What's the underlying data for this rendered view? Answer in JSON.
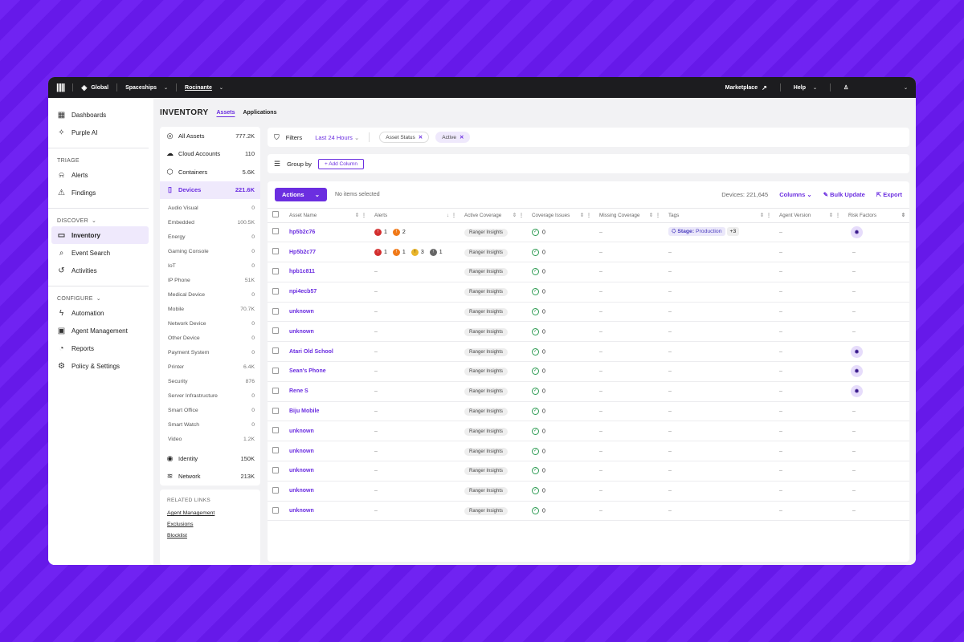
{
  "topbar": {
    "scope": "Global",
    "account": "Spaceships",
    "site": "Rocinante",
    "marketplace": "Marketplace",
    "help": "Help"
  },
  "sidebar": {
    "top_items": [
      {
        "label": "Dashboards",
        "icon": "dashboard-icon"
      },
      {
        "label": "Purple AI",
        "icon": "sparkle-icon"
      }
    ],
    "triage_title": "TRIAGE",
    "triage_items": [
      {
        "label": "Alerts",
        "icon": "alarm-icon"
      },
      {
        "label": "Findings",
        "icon": "warning-icon"
      }
    ],
    "discover_title": "DISCOVER",
    "discover_items": [
      {
        "label": "Inventory",
        "icon": "inventory-icon"
      },
      {
        "label": "Event Search",
        "icon": "search-icon"
      },
      {
        "label": "Activities",
        "icon": "history-icon"
      }
    ],
    "configure_title": "CONFIGURE",
    "configure_items": [
      {
        "label": "Automation",
        "icon": "bolt-icon"
      },
      {
        "label": "Agent Management",
        "icon": "agent-icon"
      },
      {
        "label": "Reports",
        "icon": "chart-icon"
      },
      {
        "label": "Policy & Settings",
        "icon": "gear-icon"
      }
    ]
  },
  "header": {
    "title": "INVENTORY",
    "tabs": [
      "Assets",
      "Applications"
    ]
  },
  "categories": {
    "main": [
      {
        "label": "All Assets",
        "count": "777.2K"
      },
      {
        "label": "Cloud Accounts",
        "count": "110"
      },
      {
        "label": "Containers",
        "count": "5.6K"
      },
      {
        "label": "Devices",
        "count": "221.6K"
      }
    ],
    "devices": [
      {
        "label": "Audio Visual",
        "count": "0"
      },
      {
        "label": "Embedded",
        "count": "100.5K"
      },
      {
        "label": "Energy",
        "count": "0"
      },
      {
        "label": "Gaming Console",
        "count": "0"
      },
      {
        "label": "IoT",
        "count": "0"
      },
      {
        "label": "IP Phone",
        "count": "51K"
      },
      {
        "label": "Medical Device",
        "count": "0"
      },
      {
        "label": "Mobile",
        "count": "70.7K"
      },
      {
        "label": "Network Device",
        "count": "0"
      },
      {
        "label": "Other Device",
        "count": "0"
      },
      {
        "label": "Payment System",
        "count": "0"
      },
      {
        "label": "Printer",
        "count": "6.4K"
      },
      {
        "label": "Security",
        "count": "876"
      },
      {
        "label": "Server Infrastructure",
        "count": "0"
      },
      {
        "label": "Smart Office",
        "count": "0"
      },
      {
        "label": "Smart Watch",
        "count": "0"
      },
      {
        "label": "Video",
        "count": "1.2K"
      }
    ],
    "bottom": [
      {
        "label": "Identity",
        "count": "150K"
      },
      {
        "label": "Network",
        "count": "213K"
      }
    ]
  },
  "related": {
    "title": "RELATED LINKS",
    "links": [
      "Agent Management",
      "Exclusions",
      "Blocklist"
    ]
  },
  "filters": {
    "label": "Filters",
    "time": "Last 24 Hours",
    "chips": [
      "Asset Status",
      "Active"
    ]
  },
  "groupby": {
    "label": "Group by",
    "add_column": "Add Column"
  },
  "toolbar": {
    "actions": "Actions",
    "no_selection": "No items selected",
    "devices_count": "Devices: 221,645",
    "columns": "Columns",
    "bulk_update": "Bulk Update",
    "export": "Export"
  },
  "columns": [
    "Asset Name",
    "Alerts",
    "Active Coverage",
    "Coverage Issues",
    "Missing Coverage",
    "Tags",
    "Agent Version",
    "Risk Factors"
  ],
  "rows": [
    {
      "name": "hp5b2c76",
      "alerts": [
        {
          "c": "r",
          "n": "1"
        },
        {
          "c": "o",
          "n": "2"
        }
      ],
      "coverage": "Ranger Insights",
      "issues": "0",
      "missing": "–",
      "tag": {
        "key": "Stage:",
        "val": "Production",
        "more": "+3"
      },
      "version": "–",
      "risk": true
    },
    {
      "name": "Hp5b2c77",
      "alerts": [
        {
          "c": "r",
          "n": "1"
        },
        {
          "c": "o",
          "n": "1"
        },
        {
          "c": "y",
          "n": "3"
        },
        {
          "c": "g",
          "n": "1"
        }
      ],
      "coverage": "Ranger Insights",
      "issues": "0",
      "missing": "–",
      "tag": null,
      "version": "–",
      "risk": false
    },
    {
      "name": "hpb1c811",
      "alerts": [],
      "coverage": "Ranger Insights",
      "issues": "0",
      "missing": "–",
      "tag": null,
      "version": "–",
      "risk": false
    },
    {
      "name": "npi4ecb57",
      "alerts": [],
      "coverage": "Ranger Insights",
      "issues": "0",
      "missing": "–",
      "tag": null,
      "version": "–",
      "risk": false
    },
    {
      "name": "unknown",
      "alerts": [],
      "coverage": "Ranger Insights",
      "issues": "0",
      "missing": "–",
      "tag": null,
      "version": "–",
      "risk": false
    },
    {
      "name": "unknown",
      "alerts": [],
      "coverage": "Ranger Insights",
      "issues": "0",
      "missing": "–",
      "tag": null,
      "version": "–",
      "risk": false
    },
    {
      "name": "Atari Old School",
      "alerts": [],
      "coverage": "Ranger Insights",
      "issues": "0",
      "missing": "–",
      "tag": null,
      "version": "–",
      "risk": true
    },
    {
      "name": "Sean's Phone",
      "alerts": [],
      "coverage": "Ranger Insights",
      "issues": "0",
      "missing": "–",
      "tag": null,
      "version": "–",
      "risk": true
    },
    {
      "name": "Rene S",
      "alerts": [],
      "coverage": "Ranger Insights",
      "issues": "0",
      "missing": "–",
      "tag": null,
      "version": "–",
      "risk": true
    },
    {
      "name": "Biju Mobile",
      "alerts": [],
      "coverage": "Ranger Insights",
      "issues": "0",
      "missing": "–",
      "tag": null,
      "version": "–",
      "risk": false
    },
    {
      "name": "unknown",
      "alerts": [],
      "coverage": "Ranger Insights",
      "issues": "0",
      "missing": "–",
      "tag": null,
      "version": "–",
      "risk": false
    },
    {
      "name": "unknown",
      "alerts": [],
      "coverage": "Ranger Insights",
      "issues": "0",
      "missing": "–",
      "tag": null,
      "version": "–",
      "risk": false
    },
    {
      "name": "unknown",
      "alerts": [],
      "coverage": "Ranger Insights",
      "issues": "0",
      "missing": "–",
      "tag": null,
      "version": "–",
      "risk": false
    },
    {
      "name": "unknown",
      "alerts": [],
      "coverage": "Ranger Insights",
      "issues": "0",
      "missing": "–",
      "tag": null,
      "version": "–",
      "risk": false
    },
    {
      "name": "unknown",
      "alerts": [],
      "coverage": "Ranger Insights",
      "issues": "0",
      "missing": "–",
      "tag": null,
      "version": "–",
      "risk": false
    }
  ],
  "empty_value": "–"
}
